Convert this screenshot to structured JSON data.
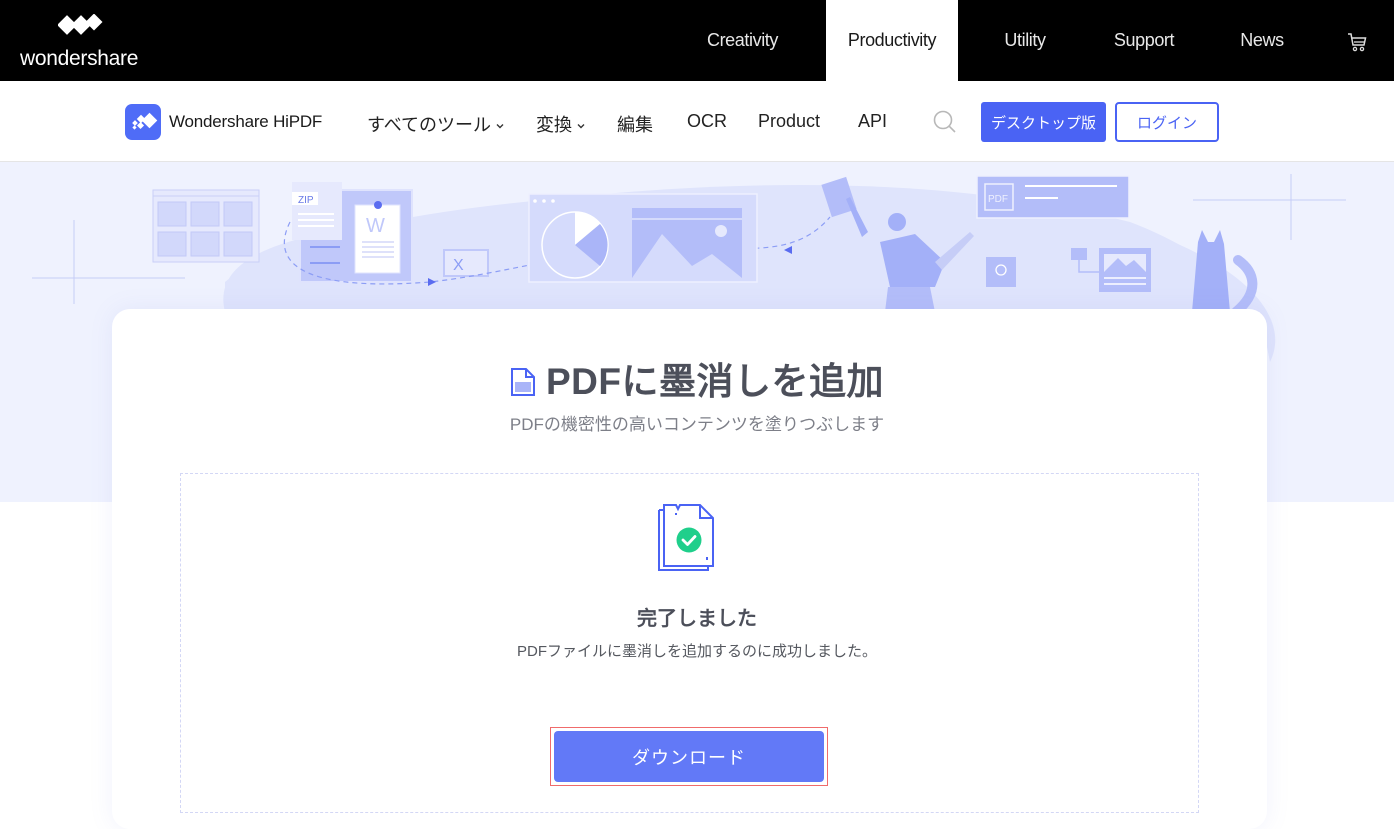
{
  "topbar": {
    "brand": "wondershare",
    "nav": [
      {
        "label": "Creativity",
        "active": false
      },
      {
        "label": "Productivity",
        "active": true
      },
      {
        "label": "Utility",
        "active": false
      },
      {
        "label": "Support",
        "active": false
      },
      {
        "label": "News",
        "active": false
      }
    ],
    "cart_icon": "shopping-cart-icon"
  },
  "subnav": {
    "product_name": "Wondershare HiPDF",
    "items": [
      {
        "label": "すべてのツール",
        "has_dropdown": true
      },
      {
        "label": "変換",
        "has_dropdown": true
      },
      {
        "label": "編集",
        "has_dropdown": false
      },
      {
        "label": "OCR",
        "has_dropdown": false
      },
      {
        "label": "Product",
        "has_dropdown": false
      },
      {
        "label": "API",
        "has_dropdown": false
      }
    ],
    "search_icon": "search-icon",
    "desktop_button": "デスクトップ版",
    "login_button": "ログイン"
  },
  "hero": {
    "illustration_labels": {
      "zip": "ZIP",
      "word": "W",
      "excel": "X",
      "pdf": "PDF"
    }
  },
  "main": {
    "title": "PDFに墨消しを追加",
    "subtitle": "PDFの機密性の高いコンテンツを塗りつぶします",
    "result": {
      "status_title": "完了しました",
      "status_message": "PDFファイルに墨消しを追加するのに成功しました。",
      "download_button": "ダウンロード"
    }
  },
  "colors": {
    "brand_blue": "#4a63f4",
    "download_blue": "#6279f7",
    "success_green": "#1fcf8b",
    "hero_bg": "#eff2fe",
    "highlight_red": "#f06b6b"
  }
}
